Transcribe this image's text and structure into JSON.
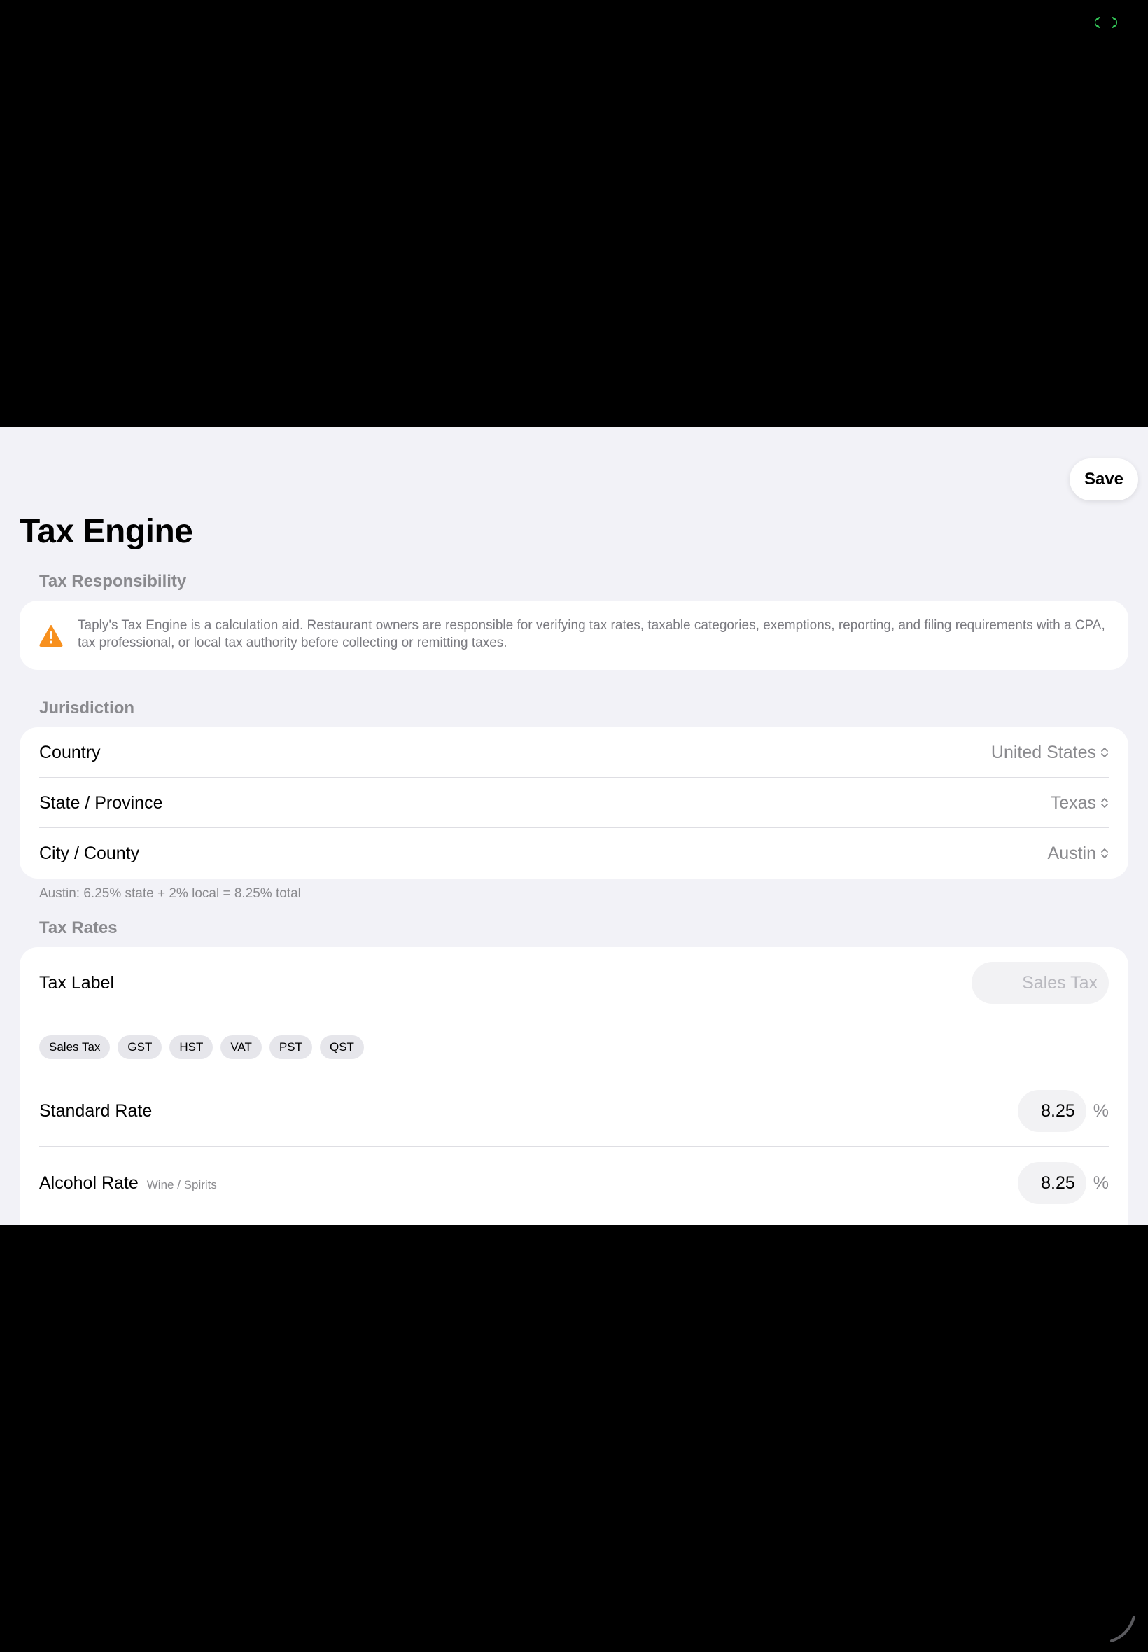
{
  "header": {
    "save_label": "Save",
    "title": "Tax Engine"
  },
  "responsibility": {
    "section_title": "Tax Responsibility",
    "icon": "warning-triangle-icon",
    "icon_color": "#f7901e",
    "text": "Taply's Tax Engine is a calculation aid. Restaurant owners are responsible for verifying tax rates, taxable categories, exemptions, reporting, and filing requirements with a CPA, tax professional, or local tax authority before collecting or remitting taxes."
  },
  "jurisdiction": {
    "section_title": "Jurisdiction",
    "rows": [
      {
        "label": "Country",
        "value": "United States"
      },
      {
        "label": "State / Province",
        "value": "Texas"
      },
      {
        "label": "City / County",
        "value": "Austin"
      }
    ],
    "note": "Austin: 6.25% state + 2% local = 8.25% total"
  },
  "tax_rates": {
    "section_title": "Tax Rates",
    "tax_label": {
      "label": "Tax Label",
      "value": "",
      "placeholder": "Sales Tax"
    },
    "presets": [
      "Sales Tax",
      "GST",
      "HST",
      "VAT",
      "PST",
      "QST"
    ],
    "standard_rate": {
      "label": "Standard Rate",
      "value": "8.25",
      "unit": "%"
    },
    "alcohol_rate": {
      "label": "Alcohol Rate",
      "sublabel": "Wine / Spirits",
      "value": "8.25",
      "unit": "%"
    }
  },
  "colors": {
    "background": "#f2f2f7",
    "card": "#ffffff",
    "secondary_text": "#8a8a8e",
    "status_indicator": "#34c759"
  }
}
